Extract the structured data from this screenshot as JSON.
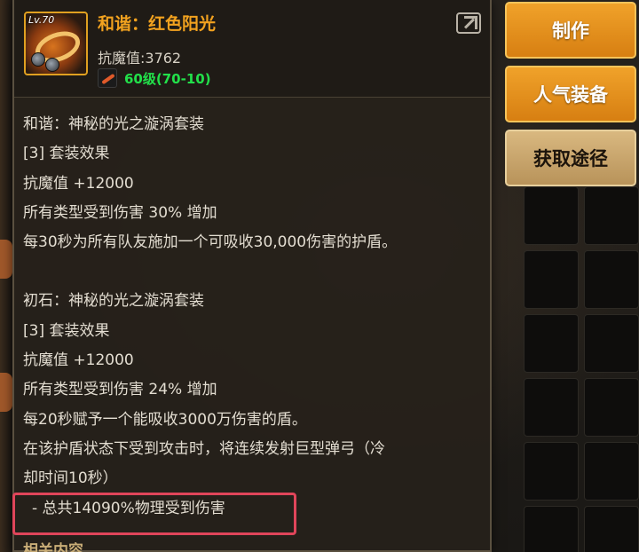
{
  "item": {
    "level_badge": "Lv.70",
    "name": "和谐：红色阳光",
    "stat": "抗魔值:3762",
    "level_text": "60级(70-10)"
  },
  "description": {
    "set1": {
      "title": "和谐：神秘的光之漩涡套装",
      "effect_header": "[3] 套装效果",
      "lines": [
        "抗魔值 +12000",
        "所有类型受到伤害 30% 增加",
        "每30秒为所有队友施加一个可吸收30,000伤害的护盾。"
      ]
    },
    "set2": {
      "title": "初石：神秘的光之漩涡套装",
      "effect_header": "[3] 套装效果",
      "lines": [
        "抗魔值 +12000",
        "所有类型受到伤害 24% 增加",
        "每20秒赋予一个能吸收3000万伤害的盾。",
        "在该护盾状态下受到攻击时，将连续发射巨型弹弓（冷",
        "却时间10秒）",
        "- 总共14090%物理受到伤害"
      ]
    },
    "related_label": "相关内容"
  },
  "buttons": {
    "craft": "制作",
    "popular": "人气装备",
    "obtain": "获取途径"
  },
  "colors": {
    "item_name": "#f2a21f",
    "level_text": "#22e04a",
    "highlight_border": "#e0455a",
    "button_orange": "#e8921f",
    "button_tan": "#c9a66b"
  }
}
